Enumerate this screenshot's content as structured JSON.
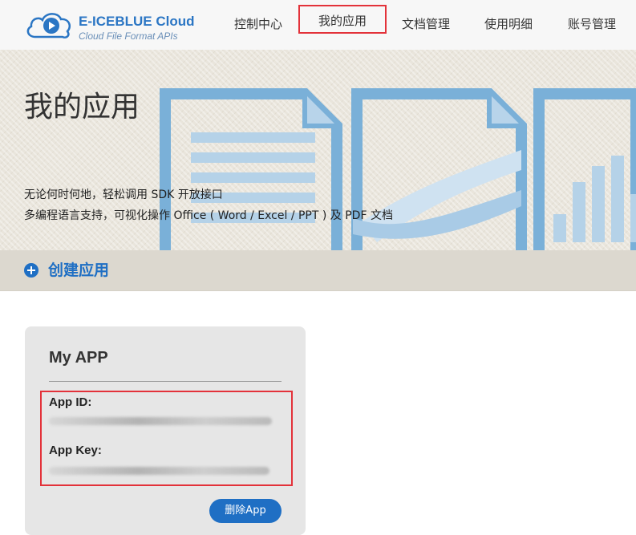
{
  "header": {
    "brand_title": "E-ICEBLUE Cloud",
    "brand_subtitle": "Cloud File Format APIs",
    "nav": [
      {
        "label": "控制中心"
      },
      {
        "label": "我的应用"
      },
      {
        "label": "文档管理"
      },
      {
        "label": "使用明细"
      },
      {
        "label": "账号管理"
      }
    ],
    "active_nav": "我的应用"
  },
  "banner": {
    "title": "我的应用",
    "line1": "无论何时何地，轻松调用 SDK 开放接口",
    "line2": "多编程语言支持，可视化操作 Office ( Word / Excel / PPT ) 及 PDF 文档"
  },
  "create": {
    "label": "创建应用"
  },
  "app_card": {
    "title": "My APP",
    "app_id_label": "App ID:",
    "app_key_label": "App Key:",
    "delete_label": "删除App"
  },
  "colors": {
    "accent": "#1f6fc4",
    "highlight": "#e3323a",
    "banner_bg": "#e9e5dc",
    "doc_blue": "#7ab0d8"
  }
}
